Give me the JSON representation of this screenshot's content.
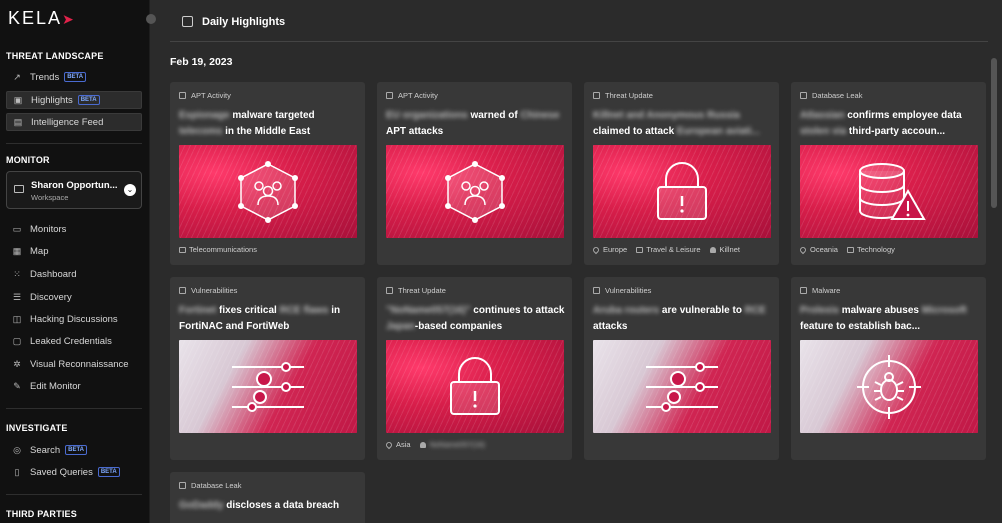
{
  "app": {
    "logo": "KELA"
  },
  "sidebar": {
    "threat_landscape": {
      "title": "THREAT LANDSCAPE",
      "items": [
        {
          "label": "Trends",
          "badge": "BETA"
        },
        {
          "label": "Highlights",
          "badge": "BETA"
        },
        {
          "label": "Intelligence Feed",
          "badge": ""
        }
      ]
    },
    "monitor": {
      "title": "MONITOR",
      "workspace": {
        "name": "Sharon Opportun...",
        "sub": "Workspace"
      },
      "items": [
        {
          "label": "Monitors"
        },
        {
          "label": "Map"
        },
        {
          "label": "Dashboard"
        },
        {
          "label": "Discovery"
        },
        {
          "label": "Hacking Discussions"
        },
        {
          "label": "Leaked Credentials"
        },
        {
          "label": "Visual Reconnaissance"
        },
        {
          "label": "Edit Monitor"
        }
      ]
    },
    "investigate": {
      "title": "INVESTIGATE",
      "items": [
        {
          "label": "Search",
          "badge": "BETA"
        },
        {
          "label": "Saved Queries",
          "badge": "BETA"
        }
      ]
    },
    "third_parties": {
      "title": "THIRD PARTIES"
    }
  },
  "main": {
    "page_title": "Daily Highlights",
    "date": "Feb 19, 2023",
    "cards": [
      {
        "category": "APT Activity",
        "title_blur": "Espionage",
        "title_a": " malware targeted ",
        "title_blur2": "telecoms",
        "title_b": " in the Middle East",
        "tags": [
          "Telecommunications"
        ]
      },
      {
        "category": "APT Activity",
        "title_blur": "EU organizations",
        "title_a": " warned of ",
        "title_blur2": "Chinese",
        "title_b": " APT attacks",
        "tags": []
      },
      {
        "category": "Threat Update",
        "title_blur": "Killnet and Anonymous Russia",
        "title_a": " claimed to attack ",
        "title_blur2": "European aviati...",
        "title_b": "",
        "tags": [
          "Europe",
          "Travel & Leisure",
          "Killnet"
        ]
      },
      {
        "category": "Database Leak",
        "title_blur": "Atlassian",
        "title_a": " confirms employee data ",
        "title_blur2": "stolen via",
        "title_b": " third-party accoun...",
        "tags": [
          "Oceania",
          "Technology"
        ]
      },
      {
        "category": "Vulnerabilities",
        "title_blur": "Fortinet",
        "title_a": " fixes critical ",
        "title_blur2": "RCE flaws",
        "title_b": " in FortiNAC and FortiWeb",
        "tags": []
      },
      {
        "category": "Threat Update",
        "title_blur": "\"NoName057(16)\"",
        "title_a": " continues to attack ",
        "title_blur2": "Japan",
        "title_b": "-based companies",
        "tags": [
          "Asia",
          "NoName057(16)"
        ]
      },
      {
        "category": "Vulnerabilities",
        "title_blur": "Aruba routers",
        "title_a": " are vulnerable to ",
        "title_blur2": "RCE",
        "title_b": " attacks",
        "tags": []
      },
      {
        "category": "Malware",
        "title_blur": "Prolexis",
        "title_a": " malware abuses ",
        "title_blur2": "Microsoft",
        "title_b": " feature to establish bac...",
        "tags": []
      },
      {
        "category": "Database Leak",
        "title_blur": "GoDaddy",
        "title_a": " discloses a data breach",
        "title_blur2": "",
        "title_b": "",
        "tags": []
      }
    ]
  }
}
